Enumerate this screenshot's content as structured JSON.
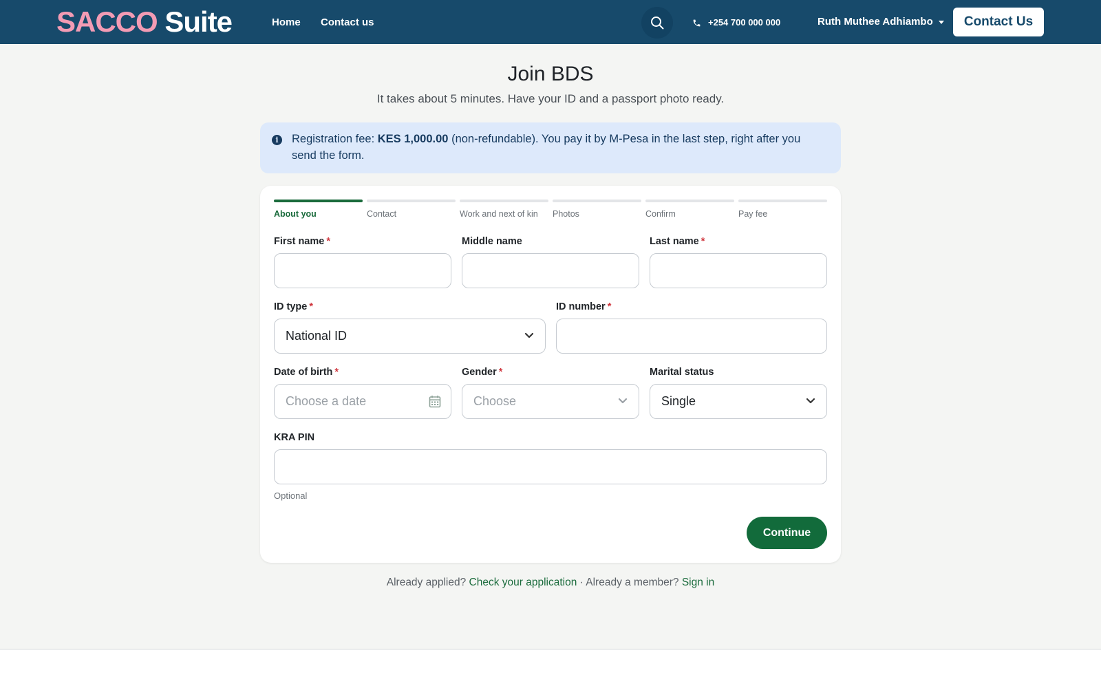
{
  "header": {
    "logo_part1": "SACCO",
    "logo_part2": "Suite",
    "nav": [
      {
        "label": "Home"
      },
      {
        "label": "Contact us"
      }
    ],
    "phone": "+254 700 000 000",
    "user_name": "Ruth Muthee Adhiambo",
    "cta": "Contact Us"
  },
  "page": {
    "title": "Join BDS",
    "subtitle": "It takes about 5 minutes. Have your ID and a passport photo ready."
  },
  "alert": {
    "prefix": "Registration fee: ",
    "amount": "KES 1,000.00",
    "suffix": " (non-refundable). You pay it by M-Pesa in the last step, right after you send the form."
  },
  "steps": [
    {
      "label": "About you",
      "active": true
    },
    {
      "label": "Contact",
      "active": false
    },
    {
      "label": "Work and next of kin",
      "active": false
    },
    {
      "label": "Photos",
      "active": false
    },
    {
      "label": "Confirm",
      "active": false
    },
    {
      "label": "Pay fee",
      "active": false
    }
  ],
  "form": {
    "first_name": {
      "label": "First name",
      "required_mark": "*",
      "value": ""
    },
    "middle_name": {
      "label": "Middle name",
      "value": ""
    },
    "last_name": {
      "label": "Last name",
      "required_mark": "*",
      "value": ""
    },
    "id_type": {
      "label": "ID type",
      "required_mark": "*",
      "value": "National ID"
    },
    "id_number": {
      "label": "ID number",
      "required_mark": "*",
      "value": ""
    },
    "dob": {
      "label": "Date of birth",
      "required_mark": "*",
      "placeholder": "Choose a date"
    },
    "gender": {
      "label": "Gender",
      "required_mark": "*",
      "placeholder": "Choose"
    },
    "marital": {
      "label": "Marital status",
      "value": "Single"
    },
    "kra": {
      "label": "KRA PIN",
      "value": "",
      "helper": "Optional"
    },
    "continue_label": "Continue"
  },
  "footer": {
    "text1": "Already applied? ",
    "link1": "Check your application",
    "text2": " · Already a member? ",
    "link2": "Sign in"
  },
  "colors": {
    "header_bg": "#174a6b",
    "primary_green": "#126b3b",
    "logo_pink": "#f39bb4",
    "alert_bg": "#dde9fb",
    "required_red": "#d0383f"
  }
}
